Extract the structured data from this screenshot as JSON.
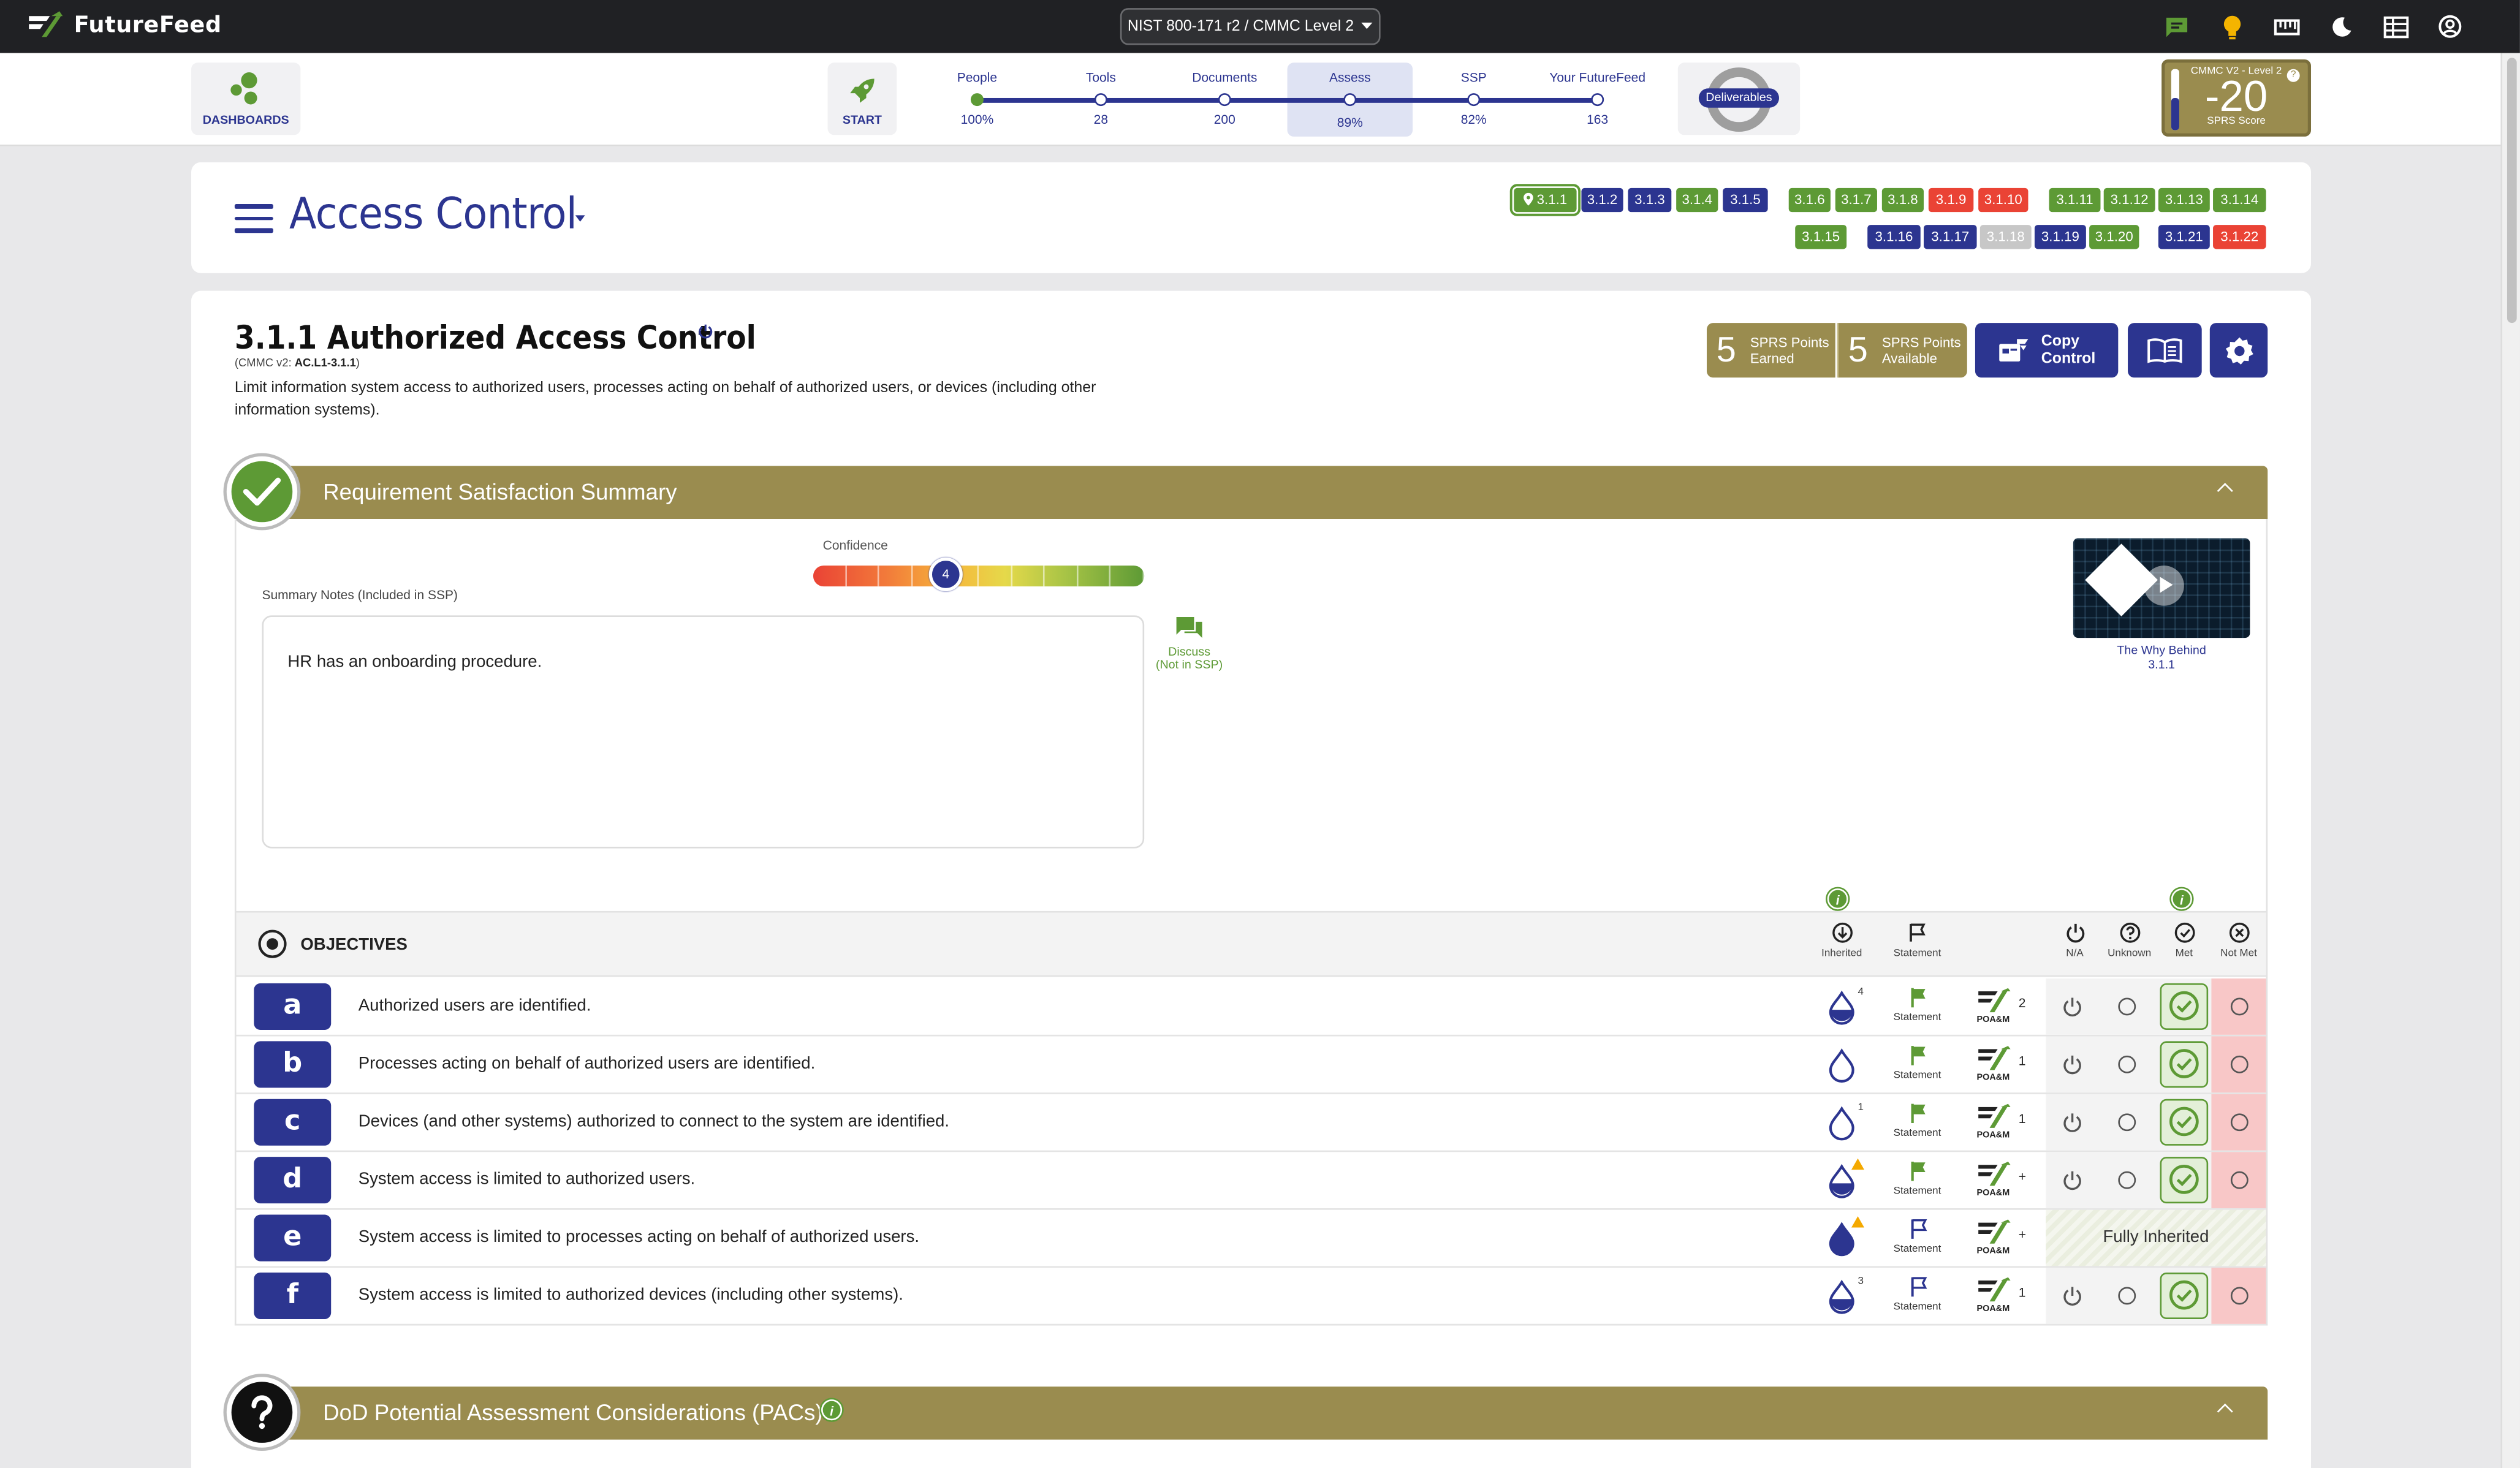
{
  "app": {
    "name": "FutureFeed"
  },
  "framework_selector": {
    "value": "NIST 800-171 r2 / CMMC Level 2"
  },
  "nav": {
    "dashboards_label": "DASHBOARDS",
    "start_label": "START",
    "deliverables_label": "Deliverables"
  },
  "steps": [
    {
      "name": "People",
      "value": "100%"
    },
    {
      "name": "Tools",
      "value": "28"
    },
    {
      "name": "Documents",
      "value": "200"
    },
    {
      "name": "Assess",
      "value": "89%"
    },
    {
      "name": "SSP",
      "value": "82%"
    },
    {
      "name": "Your FutureFeed",
      "value": "163"
    }
  ],
  "sprs": {
    "level": "CMMC V2 - Level 2",
    "score": "-20",
    "label": "SPRS Score"
  },
  "family": {
    "title": "Access Control"
  },
  "control_chips": [
    {
      "label": "3.1.1",
      "status": "sel"
    },
    {
      "label": "3.1.2",
      "status": "b"
    },
    {
      "label": "3.1.3",
      "status": "b"
    },
    {
      "label": "3.1.4",
      "status": "g"
    },
    {
      "label": "3.1.5",
      "status": "b"
    },
    {
      "label": "3.1.6",
      "status": "g"
    },
    {
      "label": "3.1.7",
      "status": "g"
    },
    {
      "label": "3.1.8",
      "status": "g"
    },
    {
      "label": "3.1.9",
      "status": "r"
    },
    {
      "label": "3.1.10",
      "status": "r"
    },
    {
      "label": "3.1.11",
      "status": "g"
    },
    {
      "label": "3.1.12",
      "status": "g"
    },
    {
      "label": "3.1.13",
      "status": "g"
    },
    {
      "label": "3.1.14",
      "status": "g"
    },
    {
      "label": "3.1.15",
      "status": "g"
    },
    {
      "label": "3.1.16",
      "status": "b"
    },
    {
      "label": "3.1.17",
      "status": "b"
    },
    {
      "label": "3.1.18",
      "status": "x"
    },
    {
      "label": "3.1.19",
      "status": "b"
    },
    {
      "label": "3.1.20",
      "status": "g"
    },
    {
      "label": "3.1.21",
      "status": "b"
    },
    {
      "label": "3.1.22",
      "status": "r"
    }
  ],
  "control": {
    "title": "3.1.1 Authorized Access Control",
    "cmmc_prefix": "(CMMC v2: ",
    "cmmc_id": "AC.L1-3.1.1",
    "cmmc_suffix": ")",
    "description": "Limit information system access to authorized users, processes acting on behalf of authorized users, or devices (including other information systems).",
    "points_earned": "5",
    "points_earned_label_1": "SPRS Points",
    "points_earned_label_2": "Earned",
    "points_available": "5",
    "points_available_label_1": "SPRS Points",
    "points_available_label_2": "Available",
    "copy_label_1": "Copy",
    "copy_label_2": "Control"
  },
  "summary": {
    "title": "Requirement Satisfaction Summary",
    "confidence_label": "Confidence",
    "confidence_value": "4",
    "notes_label": "Summary Notes (Included in SSP)",
    "notes_text": "HR has an onboarding procedure.",
    "discuss_label_1": "Discuss",
    "discuss_label_2": "(Not in SSP)",
    "video_caption_1": "The Why Behind",
    "video_caption_2": "3.1.1"
  },
  "objectives": {
    "title": "OBJECTIVES",
    "columns": {
      "inherited": "Inherited",
      "statement": "Statement",
      "na": "N/A",
      "unknown": "Unknown",
      "met": "Met",
      "not_met": "Not Met"
    },
    "statement_label": "Statement",
    "poam_label": "POA&M",
    "fully_inherited_label": "Fully Inherited",
    "rows": [
      {
        "letter": "a",
        "text": "Authorized users are identified.",
        "inherited_count": "4",
        "poam_count": "2"
      },
      {
        "letter": "b",
        "text": "Processes acting on behalf of authorized users are identified.",
        "inherited_count": "",
        "poam_count": "1"
      },
      {
        "letter": "c",
        "text": "Devices (and other systems) authorized to connect to the system are identified.",
        "inherited_count": "1",
        "poam_count": "1"
      },
      {
        "letter": "d",
        "text": "System access is limited to authorized users.",
        "inherited_count": "",
        "poam_count": "+"
      },
      {
        "letter": "e",
        "text": "System access is limited to processes acting on behalf of authorized users.",
        "inherited_count": "",
        "poam_count": "+"
      },
      {
        "letter": "f",
        "text": "System access is limited to authorized devices (including other systems).",
        "inherited_count": "3",
        "poam_count": "1"
      }
    ]
  },
  "pacs": {
    "title": "DoD Potential Assessment Considerations (PACs)"
  },
  "colors": {
    "brand_blue": "#2c3590",
    "green": "#5d9a35",
    "red": "#ea4335",
    "olive": "#9a8c4f"
  }
}
